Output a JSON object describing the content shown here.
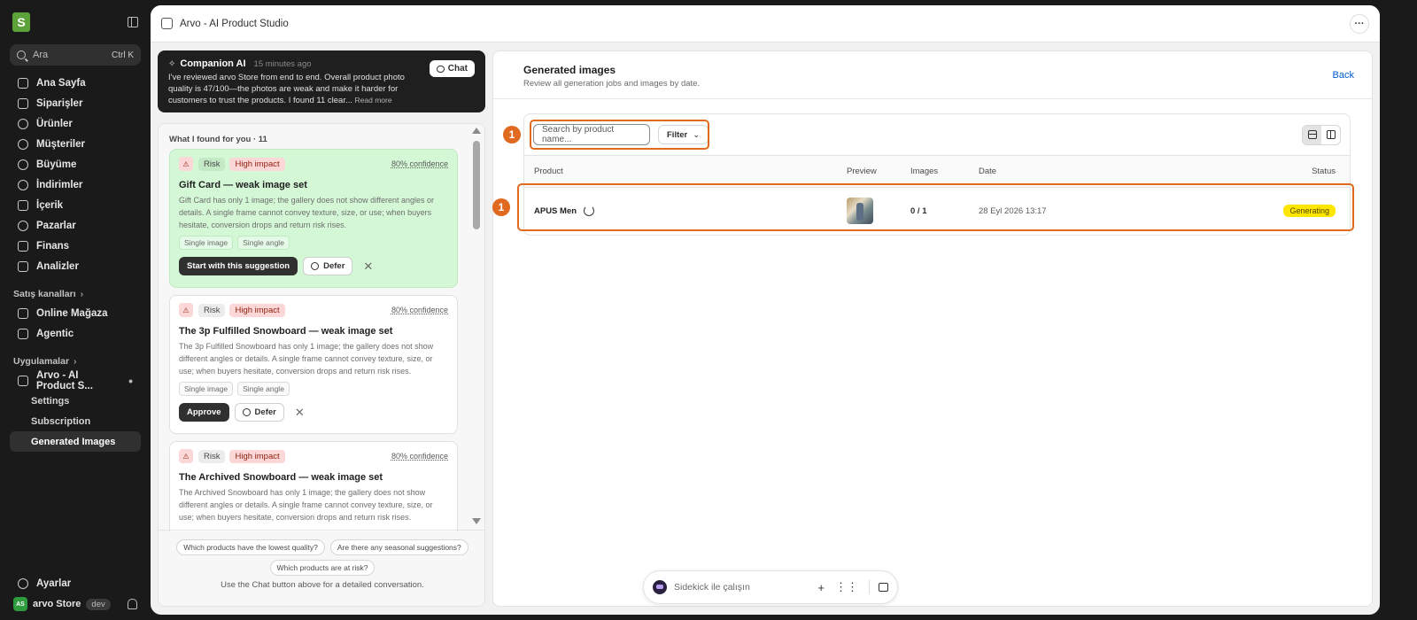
{
  "sidebar": {
    "search": {
      "placeholder": "Ara",
      "shortcut": "Ctrl K"
    },
    "nav": [
      {
        "label": "Ana Sayfa",
        "icon": "home-icon"
      },
      {
        "label": "Siparişler",
        "icon": "orders-icon"
      },
      {
        "label": "Ürünler",
        "icon": "tag-icon"
      },
      {
        "label": "Müşteriler",
        "icon": "person-icon"
      },
      {
        "label": "Büyüme",
        "icon": "growth-icon"
      },
      {
        "label": "İndirimler",
        "icon": "discount-icon"
      },
      {
        "label": "İçerik",
        "icon": "content-icon"
      },
      {
        "label": "Pazarlar",
        "icon": "globe-icon"
      },
      {
        "label": "Finans",
        "icon": "bank-icon"
      },
      {
        "label": "Analizler",
        "icon": "chart-icon"
      }
    ],
    "sales_channels_label": "Satış kanalları",
    "channels": [
      {
        "label": "Online Mağaza",
        "icon": "store-icon"
      },
      {
        "label": "Agentic",
        "icon": "agentic-icon"
      }
    ],
    "apps_label": "Uygulamalar",
    "app": {
      "label": "Arvo - AI Product S...",
      "icon": "app-icon"
    },
    "app_sub": [
      "Settings",
      "Subscription",
      "Generated Images"
    ],
    "settings_label": "Ayarlar",
    "store": {
      "avatar": "AS",
      "name": "arvo Store",
      "badge": "dev"
    }
  },
  "titlebar": {
    "title": "Arvo - AI Product Studio",
    "more": "···"
  },
  "companion": {
    "name": "Companion AI",
    "time": "15 minutes ago",
    "message": "I've reviewed arvo Store from end to end. Overall product photo quality is 47/100—the photos are weak and make it harder for customers to trust the products. I found 11 clear...",
    "read_more": "Read more",
    "chat_label": "Chat"
  },
  "found": {
    "header": "What I found for you · 11",
    "cards": [
      {
        "risk": "Risk",
        "impact": "High impact",
        "confidence": "80% confidence",
        "title": "Gift Card — weak image set",
        "desc": "Gift Card has only 1 image; the gallery does not show different angles or details. A single frame cannot convey texture, size, or use; when buyers hesitate, conversion drops and return risk rises.",
        "chips": [
          "Single image",
          "Single angle"
        ],
        "primary": "Start with this suggestion",
        "defer": "Defer"
      },
      {
        "risk": "Risk",
        "impact": "High impact",
        "confidence": "80% confidence",
        "title": "The 3p Fulfilled Snowboard — weak image set",
        "desc": "The 3p Fulfilled Snowboard has only 1 image; the gallery does not show different angles or details. A single frame cannot convey texture, size, or use; when buyers hesitate, conversion drops and return risk rises.",
        "chips": [
          "Single image",
          "Single angle"
        ],
        "primary": "Approve",
        "defer": "Defer"
      },
      {
        "risk": "Risk",
        "impact": "High impact",
        "confidence": "80% confidence",
        "title": "The Archived Snowboard — weak image set",
        "desc": "The Archived Snowboard has only 1 image; the gallery does not show different angles or details. A single frame cannot convey texture, size, or use; when buyers hesitate, conversion drops and return risk rises."
      }
    ],
    "suggestions": [
      "Which products have the lowest quality?",
      "Are there any seasonal suggestions?",
      "Which products are at risk?"
    ],
    "footer": "Use the Chat button above for a detailed conversation."
  },
  "generated": {
    "title": "Generated images",
    "subtitle": "Review all generation jobs and images by date.",
    "back": "Back",
    "search_placeholder": "Search by product name...",
    "filter": "Filter",
    "columns": [
      "Product",
      "Preview",
      "Images",
      "Date",
      "Status"
    ],
    "rows": [
      {
        "product": "APUS Men",
        "images": "0 / 1",
        "date": "28 Eyl 2026 13:17",
        "status": "Generating"
      }
    ]
  },
  "annotations": {
    "marker_1": "1",
    "marker_2": "1"
  },
  "sidekick": {
    "placeholder": "Sidekick ile çalışın"
  },
  "colors": {
    "accent_orange": "#e06a1f",
    "status_generating": "#ffe600",
    "highlight_green": "#d4f7d6"
  }
}
